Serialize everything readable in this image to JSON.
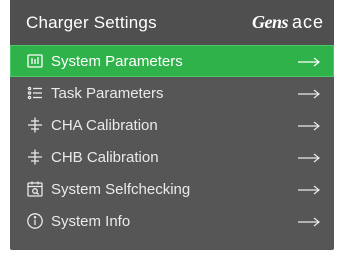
{
  "header": {
    "title": "Charger Settings",
    "brand_part1": "Gens",
    "brand_part2": "ace"
  },
  "menu": {
    "items": [
      {
        "label": "System Parameters",
        "icon": "system-parameters-icon",
        "active": true
      },
      {
        "label": "Task Parameters",
        "icon": "list-icon",
        "active": false
      },
      {
        "label": "CHA Calibration",
        "icon": "calibration-icon",
        "active": false
      },
      {
        "label": "CHB Calibration",
        "icon": "calibration-icon",
        "active": false
      },
      {
        "label": "System Selfchecking",
        "icon": "calendar-check-icon",
        "active": false
      },
      {
        "label": "System Info",
        "icon": "info-icon",
        "active": false
      }
    ]
  },
  "colors": {
    "background": "#565656",
    "header": "#4f4f4f",
    "accent": "#2fb24a",
    "text": "#eaeaea"
  }
}
